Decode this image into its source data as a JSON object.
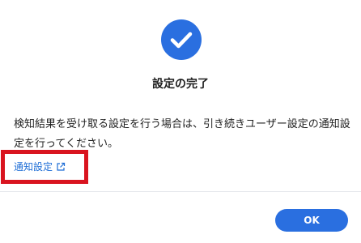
{
  "dialog": {
    "icon": "check-circle-icon",
    "title": "設定の完了",
    "message": "検知結果を受け取る設定を行う場合は、引き続きユーザー設定の通知設定を行ってください。",
    "link": {
      "label": "通知設定",
      "icon": "external-link-icon"
    },
    "ok_label": "OK"
  },
  "colors": {
    "accent": "#2a6fe0",
    "link": "#1f6ed6",
    "highlight": "#d9141f"
  }
}
